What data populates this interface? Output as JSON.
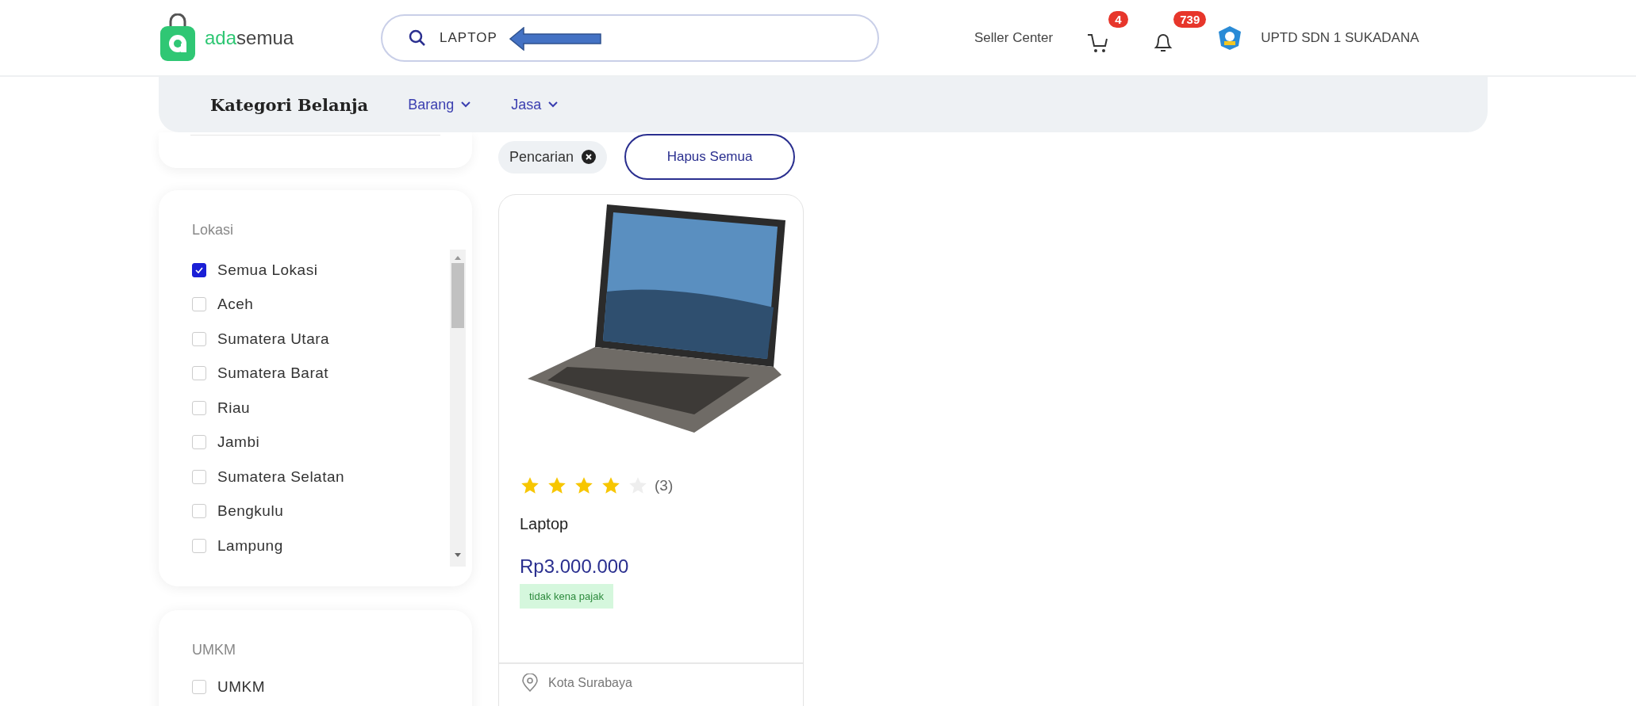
{
  "header": {
    "logo": {
      "prefix": "ada",
      "suffix": "semua"
    },
    "search": {
      "value": "LAPTOP"
    },
    "seller_center": "Seller Center",
    "cart_count": "4",
    "notification_count": "739",
    "user_name": "UPTD SDN 1 SUKADANA"
  },
  "category_bar": {
    "title": "Kategori Belanja",
    "menus": [
      {
        "label": "Barang"
      },
      {
        "label": "Jasa"
      }
    ]
  },
  "filters": {
    "location": {
      "title": "Lokasi",
      "items": [
        {
          "label": "Semua Lokasi",
          "checked": true
        },
        {
          "label": "Aceh",
          "checked": false
        },
        {
          "label": "Sumatera Utara",
          "checked": false
        },
        {
          "label": "Sumatera Barat",
          "checked": false
        },
        {
          "label": "Riau",
          "checked": false
        },
        {
          "label": "Jambi",
          "checked": false
        },
        {
          "label": "Sumatera Selatan",
          "checked": false
        },
        {
          "label": "Bengkulu",
          "checked": false
        },
        {
          "label": "Lampung",
          "checked": false
        }
      ]
    },
    "umkm": {
      "title": "UMKM",
      "items": [
        {
          "label": "UMKM",
          "checked": false
        }
      ]
    }
  },
  "active_filters": {
    "chips": [
      {
        "label": "Pencarian"
      }
    ],
    "clear_all": "Hapus Semua"
  },
  "products": [
    {
      "stars": 4,
      "review_count": "(3)",
      "name": "Laptop",
      "price": "Rp3.000.000",
      "tax_badge": "tidak kena pajak",
      "location": "Kota Surabaya"
    }
  ]
}
